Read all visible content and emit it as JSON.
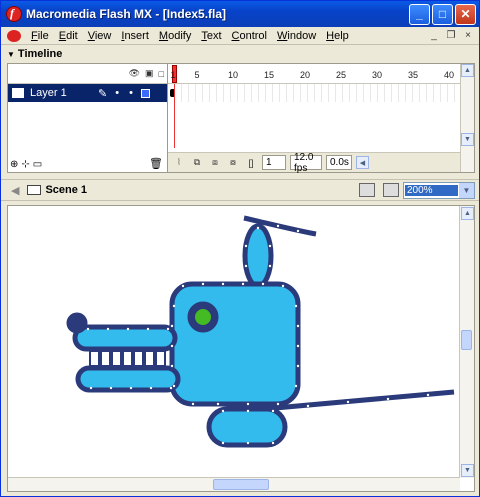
{
  "window": {
    "title": "Macromedia Flash MX - [Index5.fla]",
    "min": "_",
    "max": "□",
    "close": "✕"
  },
  "menu": [
    "File",
    "Edit",
    "View",
    "Insert",
    "Modify",
    "Text",
    "Control",
    "Window",
    "Help"
  ],
  "doc_controls": {
    "min": "_",
    "restore": "❐",
    "close": "×"
  },
  "timeline": {
    "title": "Timeline",
    "ruler_ticks": [
      "1",
      "5",
      "10",
      "15",
      "20",
      "25",
      "30",
      "35",
      "40"
    ],
    "layer_name": "Layer 1",
    "current_frame": "1",
    "frame_rate": "12.0 fps",
    "elapsed": "0.0s"
  },
  "scene": {
    "label": "Scene 1"
  },
  "zoom": {
    "value": "200%"
  },
  "colors": {
    "shape_fill": "#33bbee",
    "shape_stroke": "#2a3a7a",
    "eye": "#44bb22"
  }
}
